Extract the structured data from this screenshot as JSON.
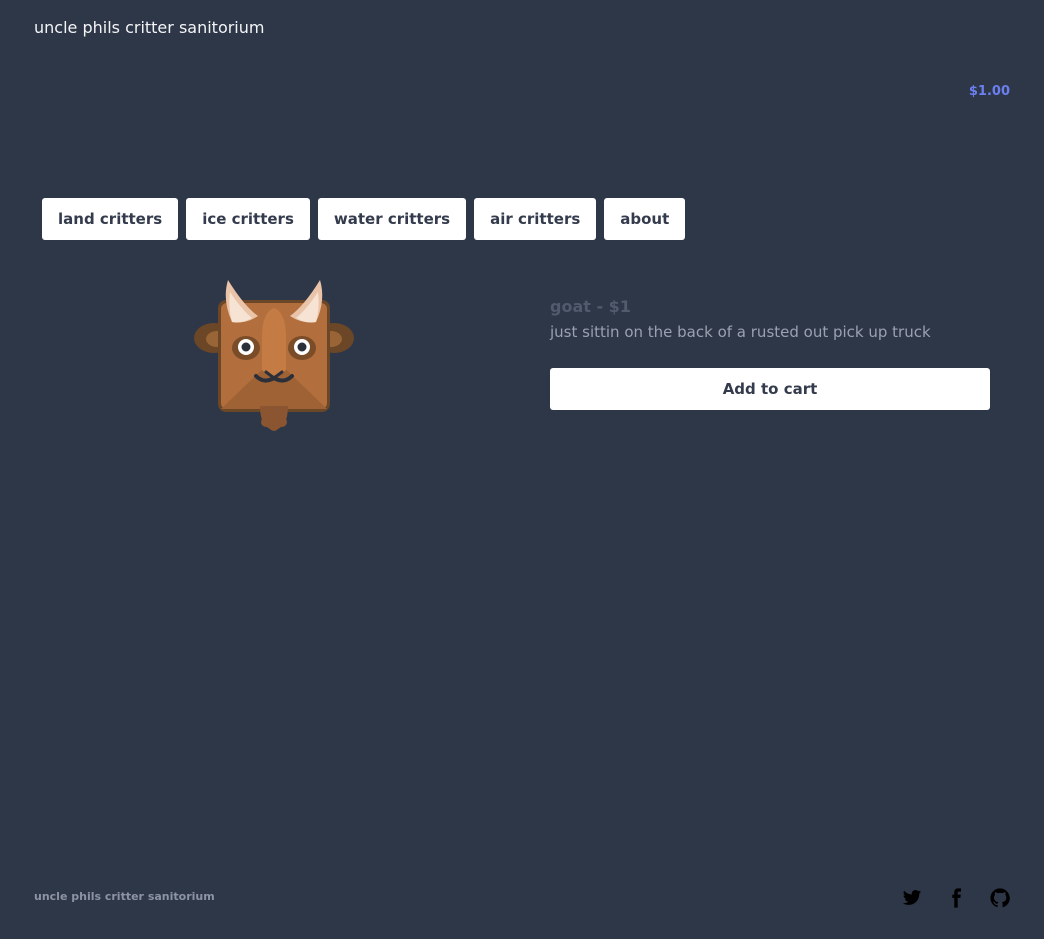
{
  "header": {
    "site_title": "uncle phils critter sanitorium",
    "cart_total": "$1.00"
  },
  "nav": {
    "items": [
      {
        "label": "land critters"
      },
      {
        "label": "ice critters"
      },
      {
        "label": "water critters"
      },
      {
        "label": "air critters"
      },
      {
        "label": "about"
      }
    ]
  },
  "product": {
    "title": "goat - $1",
    "description": "just sittin on the back of a rusted out pick up truck",
    "add_to_cart_label": "Add to cart",
    "image_icon": "goat-icon"
  },
  "footer": {
    "site_title": "uncle phils critter sanitorium",
    "social_icons": [
      "twitter-icon",
      "facebook-icon",
      "github-icon"
    ]
  },
  "colors": {
    "background": "#2e3748",
    "accent": "#6b7ff0",
    "button_bg": "#ffffff",
    "button_text": "#333b4c"
  }
}
